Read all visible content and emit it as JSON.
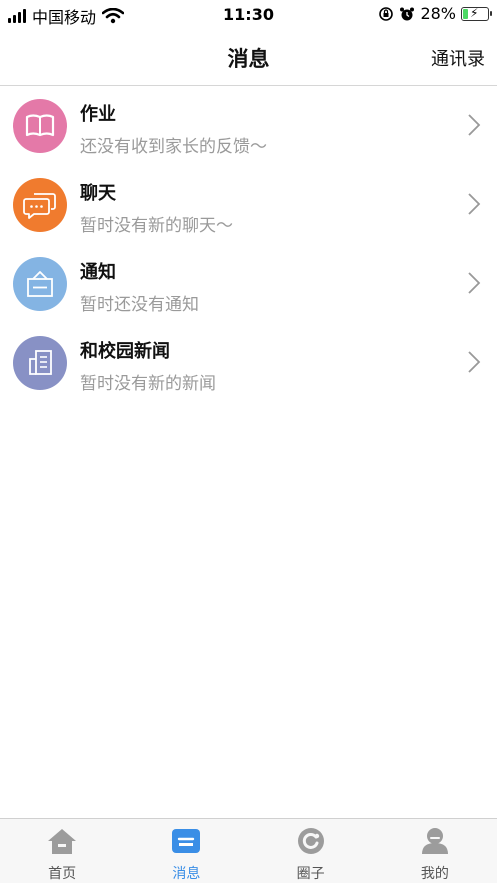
{
  "status_bar": {
    "carrier": "中国移动",
    "time": "11:30",
    "battery": "28%",
    "battery_level": 0.28
  },
  "nav": {
    "title": "消息",
    "right_label": "通讯录"
  },
  "items": [
    {
      "title": "作业",
      "subtitle": "还没有收到家长的反馈～",
      "icon": "book-icon",
      "color": "#e479a8"
    },
    {
      "title": "聊天",
      "subtitle": "暂时没有新的聊天～",
      "icon": "chat-bubbles-icon",
      "color": "#f07b2e"
    },
    {
      "title": "通知",
      "subtitle": "暂时还没有通知",
      "icon": "notice-board-icon",
      "color": "#84b4e3"
    },
    {
      "title": "和校园新闻",
      "subtitle": "暂时没有新的新闻",
      "icon": "newspaper-icon",
      "color": "#8891c5"
    }
  ],
  "tabs": [
    {
      "label": "首页",
      "icon": "home-icon",
      "active": false
    },
    {
      "label": "消息",
      "icon": "message-icon",
      "active": true
    },
    {
      "label": "圈子",
      "icon": "circle-icon",
      "active": false
    },
    {
      "label": "我的",
      "icon": "profile-icon",
      "active": false
    }
  ],
  "colors": {
    "active_tab": "#3a8ee6",
    "inactive_tab_icon": "#9c9c9c"
  }
}
